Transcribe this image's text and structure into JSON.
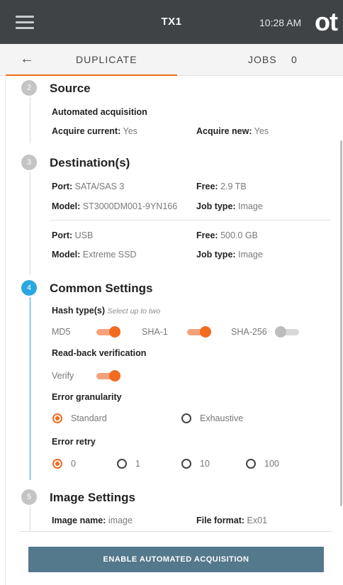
{
  "topbar": {
    "device": "TX1",
    "time": "10:28 AM",
    "brand": "ot"
  },
  "tabs": {
    "duplicate": "DUPLICATE",
    "jobs": "JOBS",
    "jobs_count": "0"
  },
  "source": {
    "step": "2",
    "title": "Source",
    "subtitle": "Automated acquisition",
    "acquire_current_label": "Acquire current:",
    "acquire_current_value": "Yes",
    "acquire_new_label": "Acquire new:",
    "acquire_new_value": "Yes"
  },
  "destinations": {
    "step": "3",
    "title": "Destination(s)",
    "items": [
      {
        "port_label": "Port:",
        "port": "SATA/SAS 3",
        "free_label": "Free:",
        "free": "2.9 TB",
        "model_label": "Model:",
        "model": "ST3000DM001-9YN166",
        "job_label": "Job type:",
        "job": "Image"
      },
      {
        "port_label": "Port:",
        "port": "USB",
        "free_label": "Free:",
        "free": "500.0 GB",
        "model_label": "Model:",
        "model": "Extreme SSD",
        "job_label": "Job type:",
        "job": "Image"
      }
    ]
  },
  "common": {
    "step": "4",
    "title": "Common Settings",
    "hash_label": "Hash type(s)",
    "hash_hint": "Select up to two",
    "hashes": [
      {
        "label": "MD5",
        "on": true
      },
      {
        "label": "SHA-1",
        "on": true
      },
      {
        "label": "SHA-256",
        "on": false
      }
    ],
    "readback_label": "Read-back verification",
    "verify_label": "Verify",
    "verify_on": true,
    "granularity_label": "Error granularity",
    "granularity_options": [
      "Standard",
      "Exhaustive"
    ],
    "granularity_selected": "Standard",
    "retry_label": "Error retry",
    "retry_options": [
      "0",
      "1",
      "10",
      "100"
    ],
    "retry_selected": "0"
  },
  "image": {
    "step": "5",
    "title": "Image Settings",
    "name_label": "Image name:",
    "name": "image",
    "format_label": "File format:",
    "format": "Ex01"
  },
  "action": {
    "cta": "ENABLE AUTOMATED ACQUISITION"
  },
  "colors": {
    "accent": "#f26b21",
    "active_step": "#2aa7e0",
    "topbar": "#3f4346",
    "button": "#54788c"
  }
}
